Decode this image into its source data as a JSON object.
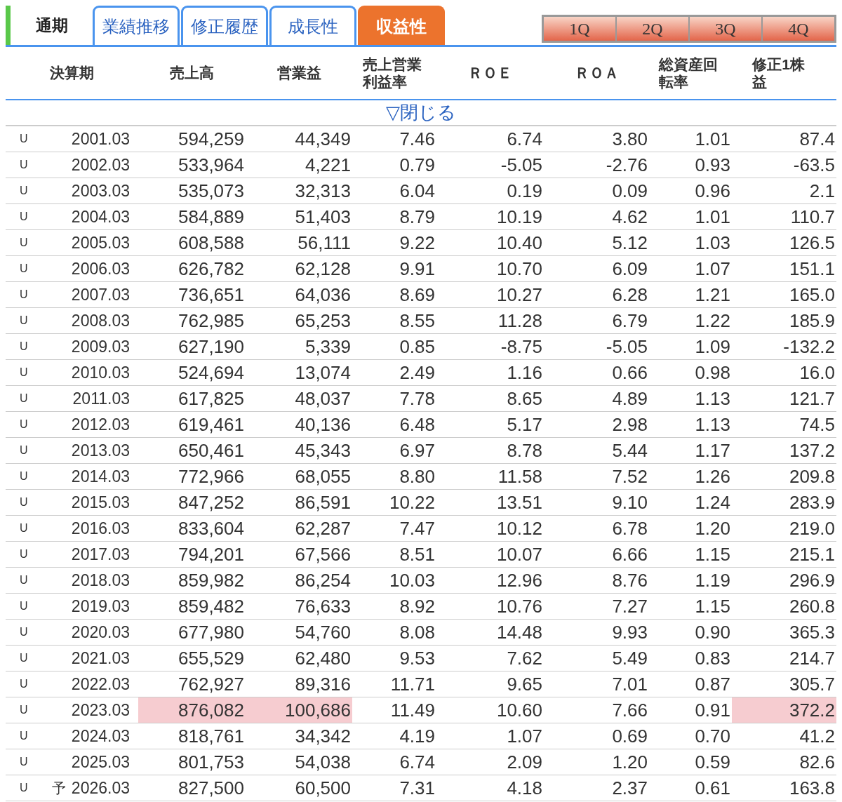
{
  "period_label": "通期",
  "tabs": [
    {
      "label": "業績推移",
      "selected": false
    },
    {
      "label": "修正履歴",
      "selected": false
    },
    {
      "label": "成長性",
      "selected": false
    },
    {
      "label": "収益性",
      "selected": true
    }
  ],
  "quarter_buttons": [
    "1Q",
    "2Q",
    "3Q",
    "4Q"
  ],
  "table": {
    "columns": [
      "決算期",
      "売上高",
      "営業益",
      "売上営業利益率",
      "ＲＯＥ",
      "ＲＯＡ",
      "総資産回転率",
      "修正1株益"
    ],
    "toggle": "▽閉じる",
    "rows": [
      {
        "mark": "U",
        "period": "2001.03",
        "values": [
          "594,259",
          "44,349",
          "7.46",
          "6.74",
          "3.80",
          "1.01",
          "87.4"
        ],
        "highlighted": [
          false,
          false,
          false,
          false,
          false,
          false,
          false
        ]
      },
      {
        "mark": "U",
        "period": "2002.03",
        "values": [
          "533,964",
          "4,221",
          "0.79",
          "-5.05",
          "-2.76",
          "0.93",
          "-63.5"
        ],
        "highlighted": [
          false,
          false,
          false,
          false,
          false,
          false,
          false
        ]
      },
      {
        "mark": "U",
        "period": "2003.03",
        "values": [
          "535,073",
          "32,313",
          "6.04",
          "0.19",
          "0.09",
          "0.96",
          "2.1"
        ],
        "highlighted": [
          false,
          false,
          false,
          false,
          false,
          false,
          false
        ]
      },
      {
        "mark": "U",
        "period": "2004.03",
        "values": [
          "584,889",
          "51,403",
          "8.79",
          "10.19",
          "4.62",
          "1.01",
          "110.7"
        ],
        "highlighted": [
          false,
          false,
          false,
          false,
          false,
          false,
          false
        ]
      },
      {
        "mark": "U",
        "period": "2005.03",
        "values": [
          "608,588",
          "56,111",
          "9.22",
          "10.40",
          "5.12",
          "1.03",
          "126.5"
        ],
        "highlighted": [
          false,
          false,
          false,
          false,
          false,
          false,
          false
        ]
      },
      {
        "mark": "U",
        "period": "2006.03",
        "values": [
          "626,782",
          "62,128",
          "9.91",
          "10.70",
          "6.09",
          "1.07",
          "151.1"
        ],
        "highlighted": [
          false,
          false,
          false,
          false,
          false,
          false,
          false
        ]
      },
      {
        "mark": "U",
        "period": "2007.03",
        "values": [
          "736,651",
          "64,036",
          "8.69",
          "10.27",
          "6.28",
          "1.21",
          "165.0"
        ],
        "highlighted": [
          false,
          false,
          false,
          false,
          false,
          false,
          false
        ]
      },
      {
        "mark": "U",
        "period": "2008.03",
        "values": [
          "762,985",
          "65,253",
          "8.55",
          "11.28",
          "6.79",
          "1.22",
          "185.9"
        ],
        "highlighted": [
          false,
          false,
          false,
          false,
          false,
          false,
          false
        ]
      },
      {
        "mark": "U",
        "period": "2009.03",
        "values": [
          "627,190",
          "5,339",
          "0.85",
          "-8.75",
          "-5.05",
          "1.09",
          "-132.2"
        ],
        "highlighted": [
          false,
          false,
          false,
          false,
          false,
          false,
          false
        ]
      },
      {
        "mark": "U",
        "period": "2010.03",
        "values": [
          "524,694",
          "13,074",
          "2.49",
          "1.16",
          "0.66",
          "0.98",
          "16.0"
        ],
        "highlighted": [
          false,
          false,
          false,
          false,
          false,
          false,
          false
        ]
      },
      {
        "mark": "U",
        "period": "2011.03",
        "values": [
          "617,825",
          "48,037",
          "7.78",
          "8.65",
          "4.89",
          "1.13",
          "121.7"
        ],
        "highlighted": [
          false,
          false,
          false,
          false,
          false,
          false,
          false
        ]
      },
      {
        "mark": "U",
        "period": "2012.03",
        "values": [
          "619,461",
          "40,136",
          "6.48",
          "5.17",
          "2.98",
          "1.13",
          "74.5"
        ],
        "highlighted": [
          false,
          false,
          false,
          false,
          false,
          false,
          false
        ]
      },
      {
        "mark": "U",
        "period": "2013.03",
        "values": [
          "650,461",
          "45,343",
          "6.97",
          "8.78",
          "5.44",
          "1.17",
          "137.2"
        ],
        "highlighted": [
          false,
          false,
          false,
          false,
          false,
          false,
          false
        ]
      },
      {
        "mark": "U",
        "period": "2014.03",
        "values": [
          "772,966",
          "68,055",
          "8.80",
          "11.58",
          "7.52",
          "1.26",
          "209.8"
        ],
        "highlighted": [
          false,
          false,
          false,
          false,
          false,
          false,
          false
        ]
      },
      {
        "mark": "U",
        "period": "2015.03",
        "values": [
          "847,252",
          "86,591",
          "10.22",
          "13.51",
          "9.10",
          "1.24",
          "283.9"
        ],
        "highlighted": [
          false,
          false,
          false,
          false,
          false,
          false,
          false
        ]
      },
      {
        "mark": "U",
        "period": "2016.03",
        "values": [
          "833,604",
          "62,287",
          "7.47",
          "10.12",
          "6.78",
          "1.20",
          "219.0"
        ],
        "highlighted": [
          false,
          false,
          false,
          false,
          false,
          false,
          false
        ]
      },
      {
        "mark": "U",
        "period": "2017.03",
        "values": [
          "794,201",
          "67,566",
          "8.51",
          "10.07",
          "6.66",
          "1.15",
          "215.1"
        ],
        "highlighted": [
          false,
          false,
          false,
          false,
          false,
          false,
          false
        ]
      },
      {
        "mark": "U",
        "period": "2018.03",
        "values": [
          "859,982",
          "86,254",
          "10.03",
          "12.96",
          "8.76",
          "1.19",
          "296.9"
        ],
        "highlighted": [
          false,
          false,
          false,
          false,
          false,
          false,
          false
        ]
      },
      {
        "mark": "U",
        "period": "2019.03",
        "values": [
          "859,482",
          "76,633",
          "8.92",
          "10.76",
          "7.27",
          "1.15",
          "260.8"
        ],
        "highlighted": [
          false,
          false,
          false,
          false,
          false,
          false,
          false
        ]
      },
      {
        "mark": "U",
        "period": "2020.03",
        "values": [
          "677,980",
          "54,760",
          "8.08",
          "14.48",
          "9.93",
          "0.90",
          "365.3"
        ],
        "highlighted": [
          false,
          false,
          false,
          false,
          false,
          false,
          false
        ]
      },
      {
        "mark": "U",
        "period": "2021.03",
        "values": [
          "655,529",
          "62,480",
          "9.53",
          "7.62",
          "5.49",
          "0.83",
          "214.7"
        ],
        "highlighted": [
          false,
          false,
          false,
          false,
          false,
          false,
          false
        ]
      },
      {
        "mark": "U",
        "period": "2022.03",
        "values": [
          "762,927",
          "89,316",
          "11.71",
          "9.65",
          "7.01",
          "0.87",
          "305.7"
        ],
        "highlighted": [
          false,
          false,
          false,
          false,
          false,
          false,
          false
        ]
      },
      {
        "mark": "U",
        "period": "2023.03",
        "values": [
          "876,082",
          "100,686",
          "11.49",
          "10.60",
          "7.66",
          "0.91",
          "372.2"
        ],
        "highlighted": [
          true,
          true,
          false,
          false,
          false,
          false,
          true
        ]
      },
      {
        "mark": "U",
        "period": "2024.03",
        "values": [
          "818,761",
          "34,342",
          "4.19",
          "1.07",
          "0.69",
          "0.70",
          "41.2"
        ],
        "highlighted": [
          false,
          false,
          false,
          false,
          false,
          false,
          false
        ]
      },
      {
        "mark": "U",
        "period": "2025.03",
        "values": [
          "801,753",
          "54,038",
          "6.74",
          "2.09",
          "1.20",
          "0.59",
          "82.6"
        ],
        "highlighted": [
          false,
          false,
          false,
          false,
          false,
          false,
          false
        ]
      },
      {
        "mark": "U",
        "forecast": "予",
        "period": "2026.03",
        "values": [
          "827,500",
          "60,500",
          "7.31",
          "4.18",
          "2.37",
          "0.61",
          "163.8"
        ],
        "highlighted": [
          false,
          false,
          false,
          false,
          false,
          false,
          false
        ]
      }
    ]
  }
}
